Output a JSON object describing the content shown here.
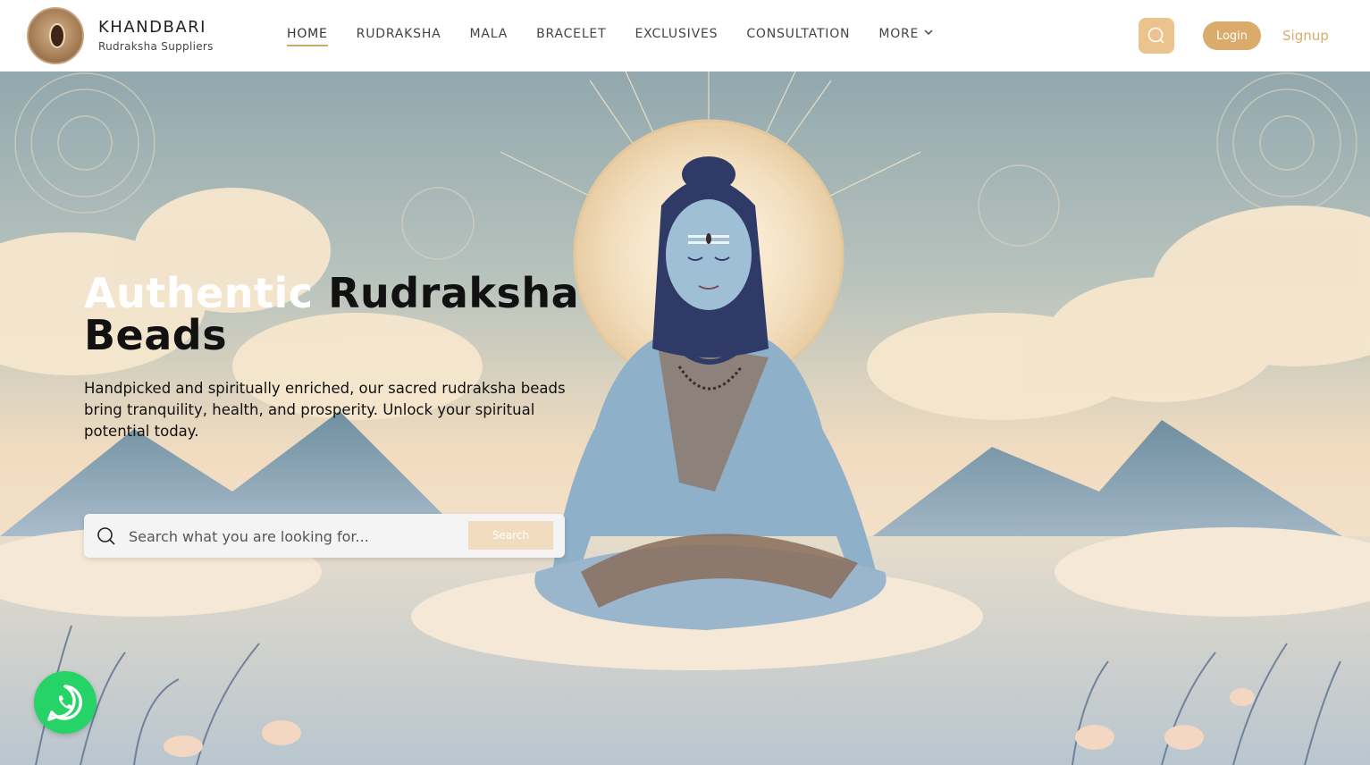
{
  "brand": {
    "name": "KHANDBARI",
    "tagline": "Rudraksha Suppliers"
  },
  "nav": {
    "items": [
      {
        "label": "HOME"
      },
      {
        "label": "RUDRAKSHA"
      },
      {
        "label": "MALA"
      },
      {
        "label": "BRACELET"
      },
      {
        "label": "EXCLUSIVES"
      },
      {
        "label": "CONSULTATION"
      },
      {
        "label": "MORE"
      }
    ],
    "active": "HOME"
  },
  "header": {
    "login_label": "Login",
    "signup_label": "Signup",
    "search_icon": "search-icon"
  },
  "hero": {
    "title_light": "Authentic",
    "title_dark": "Rudraksha",
    "title_line2": "Beads",
    "description": "Handpicked and spiritually enriched, our sacred rudraksha beads bring tranquility, health, and prosperity. Unlock your spiritual potential today.",
    "search_placeholder": "Search what you are looking for...",
    "search_button": "Search"
  },
  "colors": {
    "accent": "#d9ac6c",
    "search_icon_bg": "#ebc38e",
    "whatsapp": "#25d366"
  },
  "icons": {
    "whatsapp": "whatsapp-icon",
    "search": "search-icon",
    "chevron": "chevron-down-icon"
  }
}
